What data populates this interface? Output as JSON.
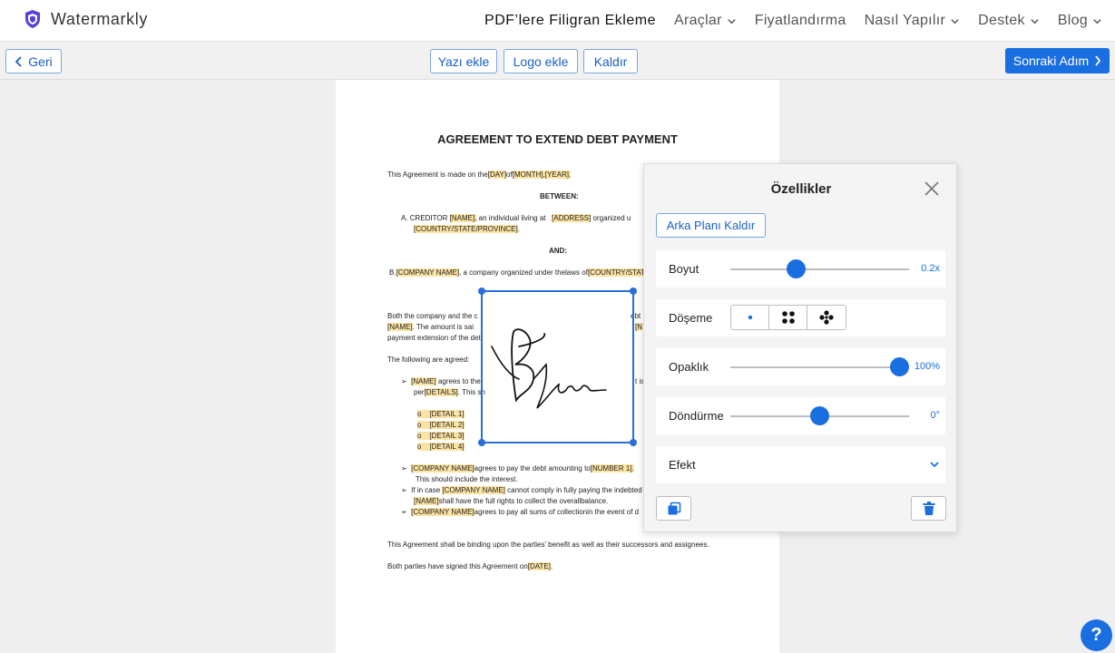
{
  "brand": {
    "name": "Watermarkly",
    "logo_icon": "shield-logo-icon"
  },
  "nav": {
    "items": [
      {
        "label": "PDF’lere Filigran Ekleme",
        "active": true,
        "dropdown": false
      },
      {
        "label": "Araçlar",
        "active": false,
        "dropdown": true
      },
      {
        "label": "Fiyatlandırma",
        "active": false,
        "dropdown": false
      },
      {
        "label": "Nasıl Yapılır",
        "active": false,
        "dropdown": true
      },
      {
        "label": "Destek",
        "active": false,
        "dropdown": true
      },
      {
        "label": "Blog",
        "active": false,
        "dropdown": true
      }
    ]
  },
  "toolbar": {
    "back_label": "Geri",
    "add_text_label": "Yazı ekle",
    "add_logo_label": "Logo ekle",
    "remove_label": "Kaldır",
    "next_label": "Sonraki Adım"
  },
  "document": {
    "title": "AGREEMENT TO EXTEND DEBT PAYMENT",
    "line1_a": "This Agreement is made on the",
    "line1_day": "[DAY]",
    "line1_of": "of",
    "line1_month": "[MONTH],[YEAR].",
    "between": "BETWEEN:",
    "creditor_a": "A.     CREDITOR",
    "creditor_name": "[NAME],",
    "creditor_b": "an individual        living at",
    "creditor_address": "[ADDRESS]",
    "creditor_c": "organized u",
    "creditor_country": "[COUNTRY/STATE/PROVINCE]",
    "creditor_end": ".",
    "and": "AND:",
    "company_a": "B.",
    "company_name": "[COMPANY NAME]",
    "company_b": ", a company organized under thelaws of",
    "company_country": "[COUNTRY/STAT",
    "both_a": "Both the company and the c",
    "both_b": "ebt",
    "name_tag": "[NAME]",
    "amount_a": ". The amount is sai",
    "amount_b": "[N",
    "payment_ext": "payment extension of the det",
    "following": "The following are agreed:",
    "b1_name": "[NAME]",
    "b1_a": "agrees to the",
    "b1_b": "t is",
    "b1_per": "per",
    "b1_details": "[DETAILS]",
    "b1_c": ". This sh",
    "details": [
      "[DETAIL 1]",
      "[DETAIL 2]",
      "[DETAIL 3]",
      "[DETAIL 4]"
    ],
    "b2_company": "[COMPANY NAME]",
    "b2_a": "agrees to pay the debt amounting to",
    "b2_number": "[NUMBER 1].",
    "b2_b": "This should include the interest.",
    "b3_a": "If in case",
    "b3_company": "[COMPANY NAME]",
    "b3_b": "cannot comply in fully paying the indebted",
    "b3_name": "[NAME]",
    "b3_c": "shall have the full rights to collect the overallbalance.",
    "b4_company": "[COMPANY NAME]",
    "b4_a": "agrees to pay all sums of collectionin the event of d",
    "binding": "This Agreement shall be binding upon the parties’ benefit as well as their successors and assignees.",
    "signed_a": "Both parties have signed this Agreement on",
    "signed_date": "[DATE]",
    "signed_end": "."
  },
  "panel": {
    "title": "Özellikler",
    "bg_remove_label": "Arka Planı Kaldır",
    "size": {
      "label": "Boyut",
      "value": "0.2x",
      "fraction": 0.35
    },
    "tiling": {
      "label": "Döşeme",
      "options": [
        "single-dot-icon",
        "four-dots-icon",
        "five-dots-icon"
      ],
      "selected": 0
    },
    "opacity": {
      "label": "Opaklık",
      "value": "100%",
      "fraction": 1.0
    },
    "rotation": {
      "label": "Döndürme",
      "value": "0°",
      "fraction": 0.5
    },
    "effect": {
      "label": "Efekt"
    }
  },
  "help_label": "?",
  "colors": {
    "accent": "#1a6fe0",
    "highlight": "#fbe3a3"
  }
}
